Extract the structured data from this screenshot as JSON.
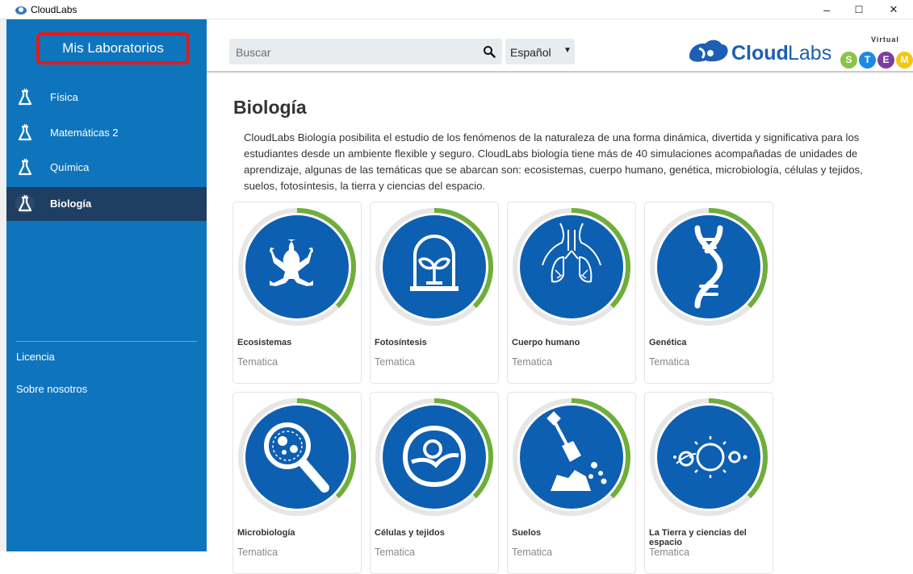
{
  "window": {
    "title": "CloudLabs",
    "minimize": "–",
    "maximize": "☐",
    "close": "✕"
  },
  "sidebar": {
    "brand": "Mis Laboratorios",
    "items": [
      {
        "label": "Física",
        "active": false
      },
      {
        "label": "Matemáticas 2",
        "active": false
      },
      {
        "label": "Química",
        "active": false
      },
      {
        "label": "Biología",
        "active": true
      }
    ],
    "footer": [
      "Licencia",
      "Sobre nosotros"
    ]
  },
  "header": {
    "search_placeholder": "Buscar",
    "language": "Español",
    "logo_text_bold": "Cloud",
    "logo_text_light": "Labs",
    "logo_tag": "Virtual",
    "logo_badges": [
      "S",
      "T",
      "E",
      "M"
    ]
  },
  "main": {
    "title": "Biología",
    "description": "CloudLabs Biología posibilita el estudio de los fenómenos de la naturaleza de una forma dinámica, divertida y significativa para los estudiantes desde un ambiente flexible y seguro. CloudLabs biología tiene más de 40 simulaciones acompañadas de unidades de aprendizaje, algunas de las temáticas que se abarcan son: ecosistemas, cuerpo humano, genética, microbiología, células y tejidos, suelos, fotosíntesis, la tierra y ciencias del espacio.",
    "cards": [
      {
        "name": "Ecosistemas",
        "sub": "Tematica",
        "icon": "frog-icon"
      },
      {
        "name": "Fotosíntesis",
        "sub": "Tematica",
        "icon": "plant-dome-icon"
      },
      {
        "name": "Cuerpo humano",
        "sub": "Tematica",
        "icon": "lungs-icon"
      },
      {
        "name": "Genética",
        "sub": "Tematica",
        "icon": "dna-icon"
      },
      {
        "name": "Microbiología",
        "sub": "Tematica",
        "icon": "magnifier-microbe-icon"
      },
      {
        "name": "Células y tejidos",
        "sub": "Tematica",
        "icon": "cell-icon"
      },
      {
        "name": "Suelos",
        "sub": "Tematica",
        "icon": "shovel-icon"
      },
      {
        "name": "La Tierra y ciencias del espacio",
        "sub": "Tematica",
        "icon": "planets-icon"
      }
    ]
  },
  "colors": {
    "sidebar": "#0e75bd",
    "active": "#1f3f62",
    "ring": "#6fae3a",
    "disc": "#0d5fb1",
    "highlight": "#e81818"
  }
}
